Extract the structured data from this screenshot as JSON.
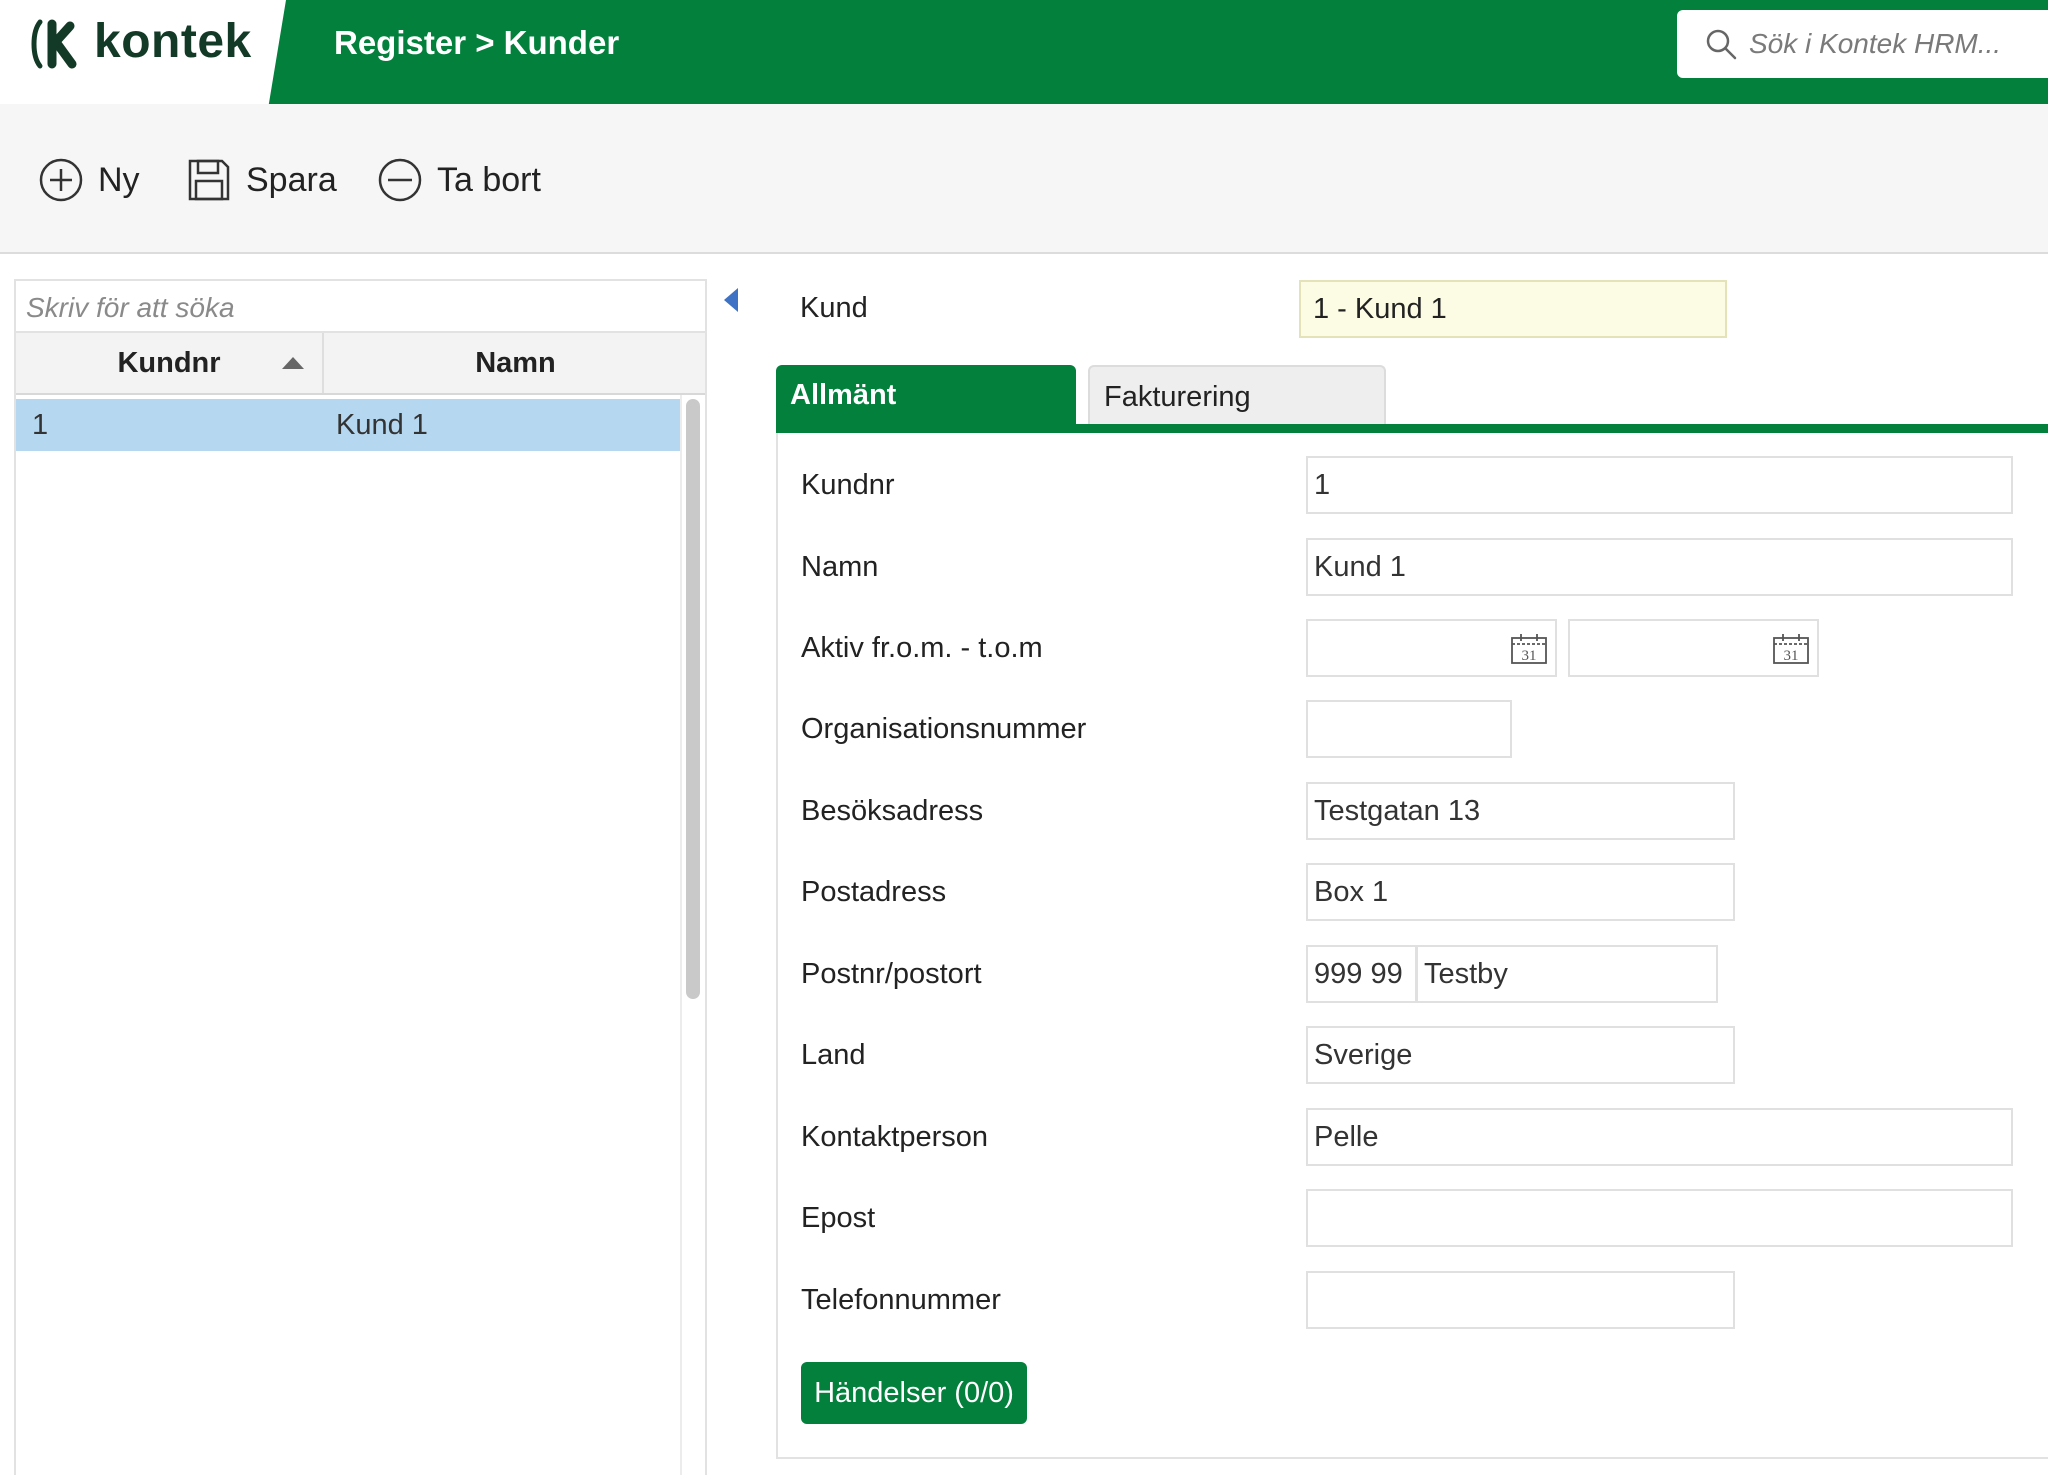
{
  "header": {
    "logo_text": "kontek",
    "breadcrumb": "Register > Kunder",
    "search_placeholder": "Sök i Kontek HRM..."
  },
  "toolbar": {
    "new_label": "Ny",
    "save_label": "Spara",
    "delete_label": "Ta bort"
  },
  "list": {
    "search_placeholder": "Skriv för att söka",
    "columns": [
      "Kundnr",
      "Namn"
    ],
    "sort": "Kundnr ascending",
    "rows": [
      {
        "kundnr": "1",
        "namn": "Kund 1",
        "selected": true
      }
    ]
  },
  "detail": {
    "selector_label": "Kund",
    "selector_value": "1 - Kund 1",
    "tabs": [
      {
        "label": "Allmänt",
        "active": true
      },
      {
        "label": "Fakturering",
        "active": false
      }
    ],
    "fields": {
      "kundnr": {
        "label": "Kundnr",
        "value": "1"
      },
      "namn": {
        "label": "Namn",
        "value": "Kund 1"
      },
      "aktiv": {
        "label": "Aktiv fr.o.m. - t.o.m",
        "from": "",
        "to": "",
        "calendar_day": "31"
      },
      "orgnr": {
        "label": "Organisationsnummer",
        "value": ""
      },
      "besoksadress": {
        "label": "Besöksadress",
        "value": "Testgatan 13"
      },
      "postadress": {
        "label": "Postadress",
        "value": "Box 1"
      },
      "postnr": {
        "label": "Postnr/postort",
        "postnr": "999 99",
        "postort": "Testby"
      },
      "land": {
        "label": "Land",
        "value": "Sverige"
      },
      "kontaktperson": {
        "label": "Kontaktperson",
        "value": "Pelle"
      },
      "epost": {
        "label": "Epost",
        "value": ""
      },
      "telefon": {
        "label": "Telefonnummer",
        "value": ""
      }
    },
    "events_button": "Händelser (0/0)"
  },
  "colors": {
    "brand_green": "#02803c",
    "selected_row": "#b5d8f0",
    "selector_bg": "#fcfbe3"
  },
  "icons": [
    "search-icon",
    "plus-circle-icon",
    "floppy-disk-icon",
    "minus-circle-icon",
    "sort-asc-icon",
    "collapse-arrow-icon",
    "calendar-icon"
  ]
}
